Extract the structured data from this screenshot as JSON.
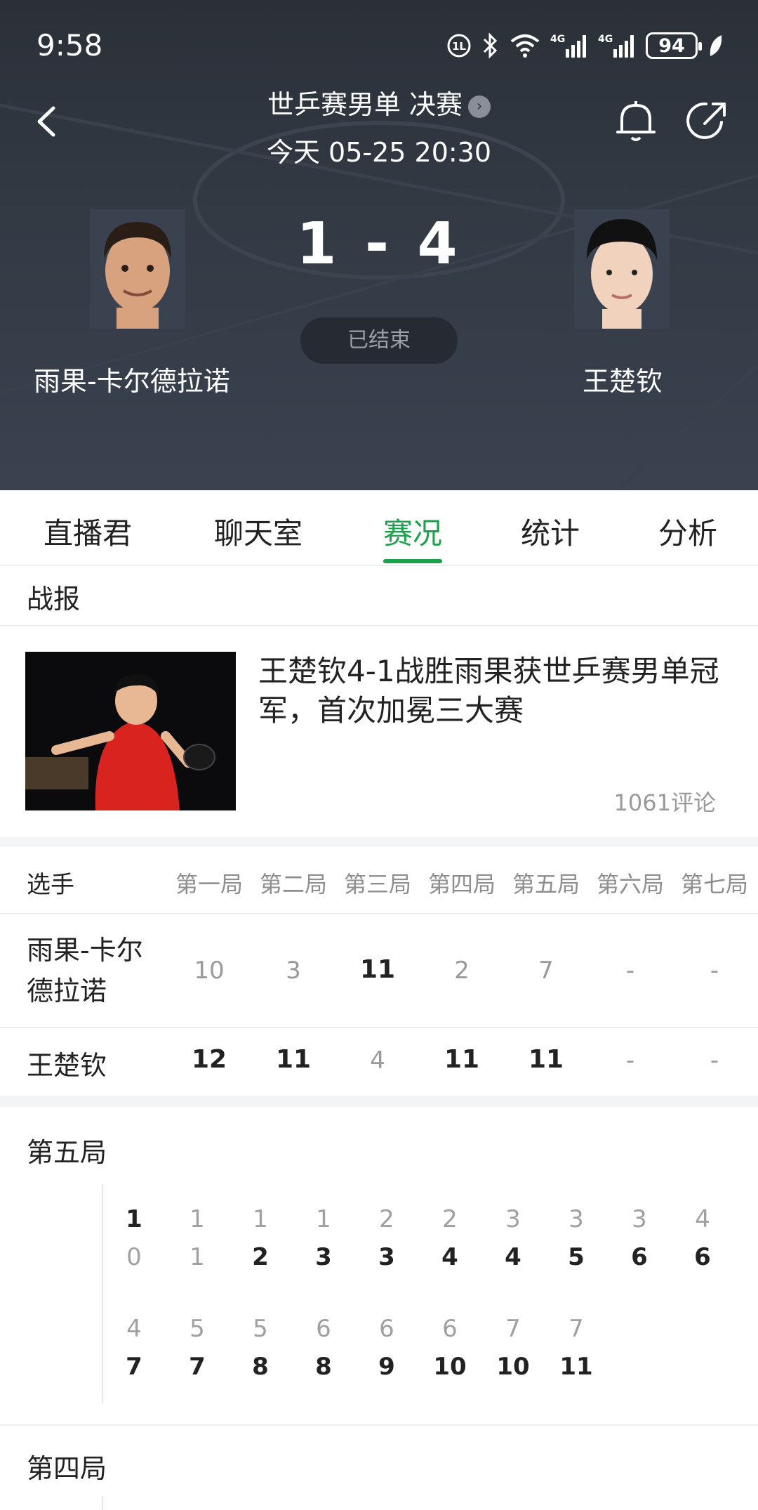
{
  "status_bar": {
    "time": "9:58",
    "battery": "94"
  },
  "header": {
    "match_title": "世乒赛男单 决赛",
    "match_time": "今天 05-25 20:30",
    "score": "1 - 4",
    "status": "已结束",
    "player_left": "雨果-卡尔德拉诺",
    "player_right": "王楚钦"
  },
  "tabs": [
    {
      "label": "直播君",
      "active": false
    },
    {
      "label": "聊天室",
      "active": false
    },
    {
      "label": "赛况",
      "active": true
    },
    {
      "label": "统计",
      "active": false
    },
    {
      "label": "分析",
      "active": false
    }
  ],
  "news": {
    "section": "战报",
    "title": "王楚钦4-1战胜雨果获世乒赛男单冠军，首次加冕三大赛",
    "comments": "1061评论"
  },
  "score_table": {
    "headers": [
      "选手",
      "第一局",
      "第二局",
      "第三局",
      "第四局",
      "第五局",
      "第六局",
      "第七局"
    ],
    "rows": [
      {
        "player_line1": "雨果-卡尔",
        "player_line2": "德拉诺",
        "scores": [
          "10",
          "3",
          "11",
          "2",
          "7",
          "-",
          "-"
        ],
        "win": [
          false,
          false,
          true,
          false,
          false,
          false,
          false
        ]
      },
      {
        "player_line1": "王楚钦",
        "player_line2": "",
        "scores": [
          "12",
          "11",
          "4",
          "11",
          "11",
          "-",
          "-"
        ],
        "win": [
          true,
          true,
          false,
          true,
          true,
          false,
          false
        ]
      }
    ]
  },
  "game5": {
    "title": "第五局",
    "row1_top": [
      "1",
      "1",
      "1",
      "1",
      "2",
      "2",
      "3",
      "3",
      "3",
      "4"
    ],
    "row1_bottom": [
      "0",
      "1",
      "2",
      "3",
      "3",
      "4",
      "4",
      "5",
      "6",
      "6"
    ],
    "row1_top_bold": [
      true,
      false,
      false,
      false,
      false,
      false,
      false,
      false,
      false,
      false
    ],
    "row1_bottom_bold": [
      false,
      false,
      true,
      true,
      true,
      true,
      true,
      true,
      true,
      true
    ],
    "row2_top": [
      "4",
      "5",
      "5",
      "6",
      "6",
      "6",
      "7",
      "7"
    ],
    "row2_bottom": [
      "7",
      "7",
      "8",
      "8",
      "9",
      "10",
      "10",
      "11"
    ]
  },
  "game4": {
    "title": "第四局"
  },
  "colors": {
    "accent": "#1aa34a",
    "hero_bg": "#333a44"
  }
}
